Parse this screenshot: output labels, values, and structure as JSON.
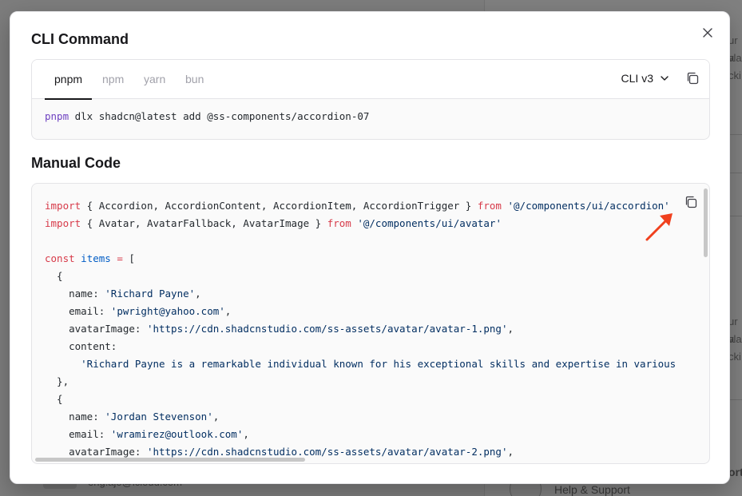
{
  "background": {
    "right_fragments": [
      "ur a",
      "vla",
      "cki",
      "ur a",
      "vla",
      "cki"
    ],
    "bottom_left_text": "eng.ajo@icloud.com",
    "bottom_right_label": "ort",
    "help_support": "Help & Support"
  },
  "modal": {
    "cli_title": "CLI Command",
    "manual_title": "Manual Code",
    "tabs": [
      {
        "label": "pnpm",
        "active": true
      },
      {
        "label": "npm",
        "active": false
      },
      {
        "label": "yarn",
        "active": false
      },
      {
        "label": "bun",
        "active": false
      }
    ],
    "cli_version": "CLI v3",
    "cli_command": {
      "bin": "pnpm",
      "rest": " dlx shadcn@latest add @ss-components/accordion-07"
    },
    "code_lines": [
      [
        [
          "kw",
          "import"
        ],
        [
          "punc",
          " { Accordion, AccordionContent, AccordionItem, AccordionTrigger } "
        ],
        [
          "kw",
          "from"
        ],
        [
          "punc",
          " "
        ],
        [
          "str",
          "'@/components/ui/accordion'"
        ]
      ],
      [
        [
          "kw",
          "import"
        ],
        [
          "punc",
          " { Avatar, AvatarFallback, AvatarImage } "
        ],
        [
          "kw",
          "from"
        ],
        [
          "punc",
          " "
        ],
        [
          "str",
          "'@/components/ui/avatar'"
        ]
      ],
      [],
      [
        [
          "kw",
          "const"
        ],
        [
          "punc",
          " "
        ],
        [
          "fn",
          "items"
        ],
        [
          "punc",
          " "
        ],
        [
          "kw",
          "="
        ],
        [
          "punc",
          " ["
        ]
      ],
      [
        [
          "punc",
          "  {"
        ]
      ],
      [
        [
          "prop",
          "    name: "
        ],
        [
          "str",
          "'Richard Payne'"
        ],
        [
          "punc",
          ","
        ]
      ],
      [
        [
          "prop",
          "    email: "
        ],
        [
          "str",
          "'pwright@yahoo.com'"
        ],
        [
          "punc",
          ","
        ]
      ],
      [
        [
          "prop",
          "    avatarImage: "
        ],
        [
          "str",
          "'https://cdn.shadcnstudio.com/ss-assets/avatar/avatar-1.png'"
        ],
        [
          "punc",
          ","
        ]
      ],
      [
        [
          "prop",
          "    content:"
        ]
      ],
      [
        [
          "punc",
          "      "
        ],
        [
          "str",
          "'Richard Payne is a remarkable individual known for his exceptional skills and expertise in various"
        ]
      ],
      [
        [
          "punc",
          "  },"
        ]
      ],
      [
        [
          "punc",
          "  {"
        ]
      ],
      [
        [
          "prop",
          "    name: "
        ],
        [
          "str",
          "'Jordan Stevenson'"
        ],
        [
          "punc",
          ","
        ]
      ],
      [
        [
          "prop",
          "    email: "
        ],
        [
          "str",
          "'wramirez@outlook.com'"
        ],
        [
          "punc",
          ","
        ]
      ],
      [
        [
          "prop",
          "    avatarImage: "
        ],
        [
          "str",
          "'https://cdn.shadcnstudio.com/ss-assets/avatar/avatar-2.png'"
        ],
        [
          "punc",
          ","
        ]
      ]
    ]
  },
  "colors": {
    "keyword": "#d73a49",
    "string": "#032f62",
    "identifier": "#005cc5",
    "annotation_arrow": "#f0401e"
  },
  "icons": {
    "close": "close-icon",
    "copy": "copy-icon",
    "chevron": "chevron-down-icon",
    "arrow": "annotation-arrow-icon"
  }
}
